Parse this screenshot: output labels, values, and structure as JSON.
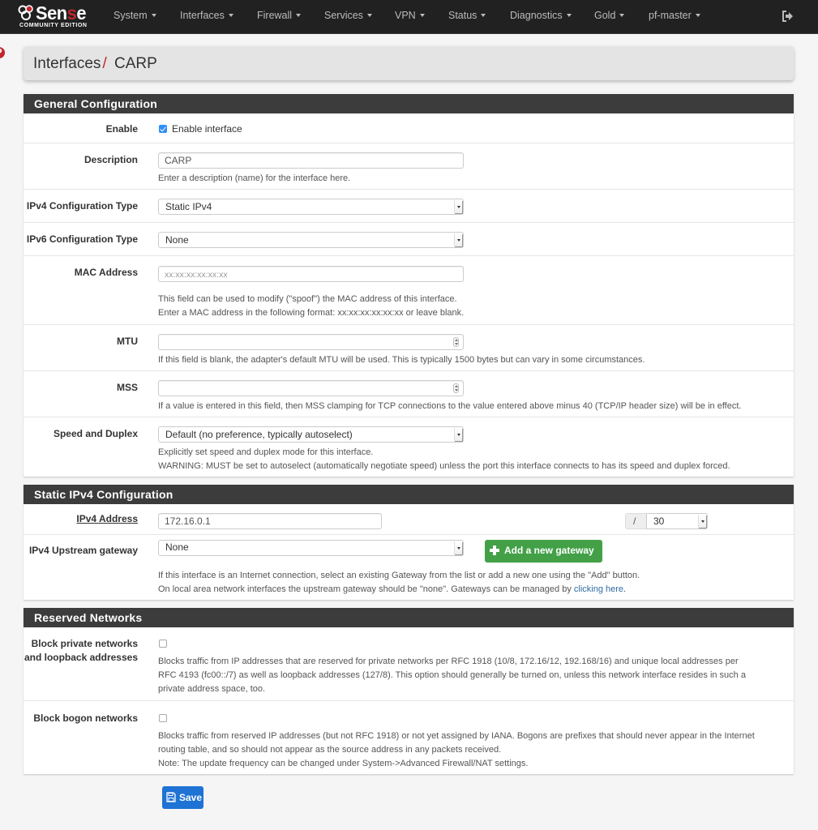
{
  "navbar": {
    "brand_main": "Sen",
    "brand_accent": "s",
    "brand_end": "e",
    "brand_sub": "COMMUNITY EDITION",
    "items": [
      {
        "label": "System"
      },
      {
        "label": "Interfaces"
      },
      {
        "label": "Firewall"
      },
      {
        "label": "Services"
      },
      {
        "label": "VPN"
      },
      {
        "label": "Status"
      },
      {
        "label": "Diagnostics"
      },
      {
        "label": "Gold"
      },
      {
        "label": "pf-master"
      }
    ],
    "logout_icon": "sign-out-icon"
  },
  "breadcrumb": {
    "parent": "Interfaces",
    "separator": "/",
    "current": "CARP",
    "icons": [
      "sliders-icon",
      "bar-chart-icon",
      "question-circle-icon"
    ]
  },
  "colors": {
    "accent_red": "#c0262c",
    "navbar": "#212121",
    "panel_header": "#3c3c3c",
    "green_button": "#43a047",
    "save_button": "#1e73d4",
    "link": "#2d6ca2"
  },
  "general": {
    "title": "General Configuration",
    "enable": {
      "label": "Enable",
      "checkbox_label": "Enable interface",
      "checked": true
    },
    "description": {
      "label": "Description",
      "value": "CARP",
      "help": "Enter a description (name) for the interface here."
    },
    "ipv4_type": {
      "label": "IPv4 Configuration Type",
      "selected": "Static IPv4"
    },
    "ipv6_type": {
      "label": "IPv6 Configuration Type",
      "selected": "None"
    },
    "mac": {
      "label": "MAC Address",
      "placeholder": "xx:xx:xx:xx:xx:xx",
      "help1": "This field can be used to modify (\"spoof\") the MAC address of this interface.",
      "help2": "Enter a MAC address in the following format: xx:xx:xx:xx:xx:xx or leave blank."
    },
    "mtu": {
      "label": "MTU",
      "value": "",
      "help": "If this field is blank, the adapter's default MTU will be used. This is typically 1500 bytes but can vary in some circumstances."
    },
    "mss": {
      "label": "MSS",
      "value": "",
      "help": "If a value is entered in this field, then MSS clamping for TCP connections to the value entered above minus 40 (TCP/IP header size) will be in effect."
    },
    "speed": {
      "label": "Speed and Duplex",
      "selected": "Default (no preference, typically autoselect)",
      "help1": "Explicitly set speed and duplex mode for this interface.",
      "help2": "WARNING: MUST be set to autoselect (automatically negotiate speed) unless the port this interface connects to has its speed and duplex forced."
    }
  },
  "static_ipv4": {
    "title": "Static IPv4 Configuration",
    "address": {
      "label": "IPv4 Address",
      "value": "172.16.0.1",
      "slash": "/",
      "cidr": "30"
    },
    "gateway": {
      "label": "IPv4 Upstream gateway",
      "selected": "None",
      "add_button": "Add a new gateway",
      "help1": "If this interface is an Internet connection, select an existing Gateway from the list or add a new one using the \"Add\" button.",
      "help2_pre": "On local area network interfaces the upstream gateway should be \"none\". Gateways can be managed by ",
      "help2_link": "clicking here",
      "help2_post": "."
    }
  },
  "reserved": {
    "title": "Reserved Networks",
    "private": {
      "label_line1": "Block private networks",
      "label_line2": "and loopback addresses",
      "checked": false,
      "help1": "Blocks traffic from IP addresses that are reserved for private networks per RFC 1918 (10/8, 172.16/12, 192.168/16) and unique local addresses per",
      "help2": "RFC 4193 (fc00::/7) as well as loopback addresses (127/8). This option should generally be turned on, unless this network interface resides in such a",
      "help3": "private address space, too."
    },
    "bogon": {
      "label": "Block bogon networks",
      "checked": false,
      "help1": "Blocks traffic from reserved IP addresses (but not RFC 1918) or not yet assigned by IANA. Bogons are prefixes that should never appear in the Internet",
      "help2": "routing table, and so should not appear as the source address in any packets received.",
      "help3": "Note: The update frequency can be changed under System->Advanced Firewall/NAT settings."
    }
  },
  "save_label": "Save"
}
